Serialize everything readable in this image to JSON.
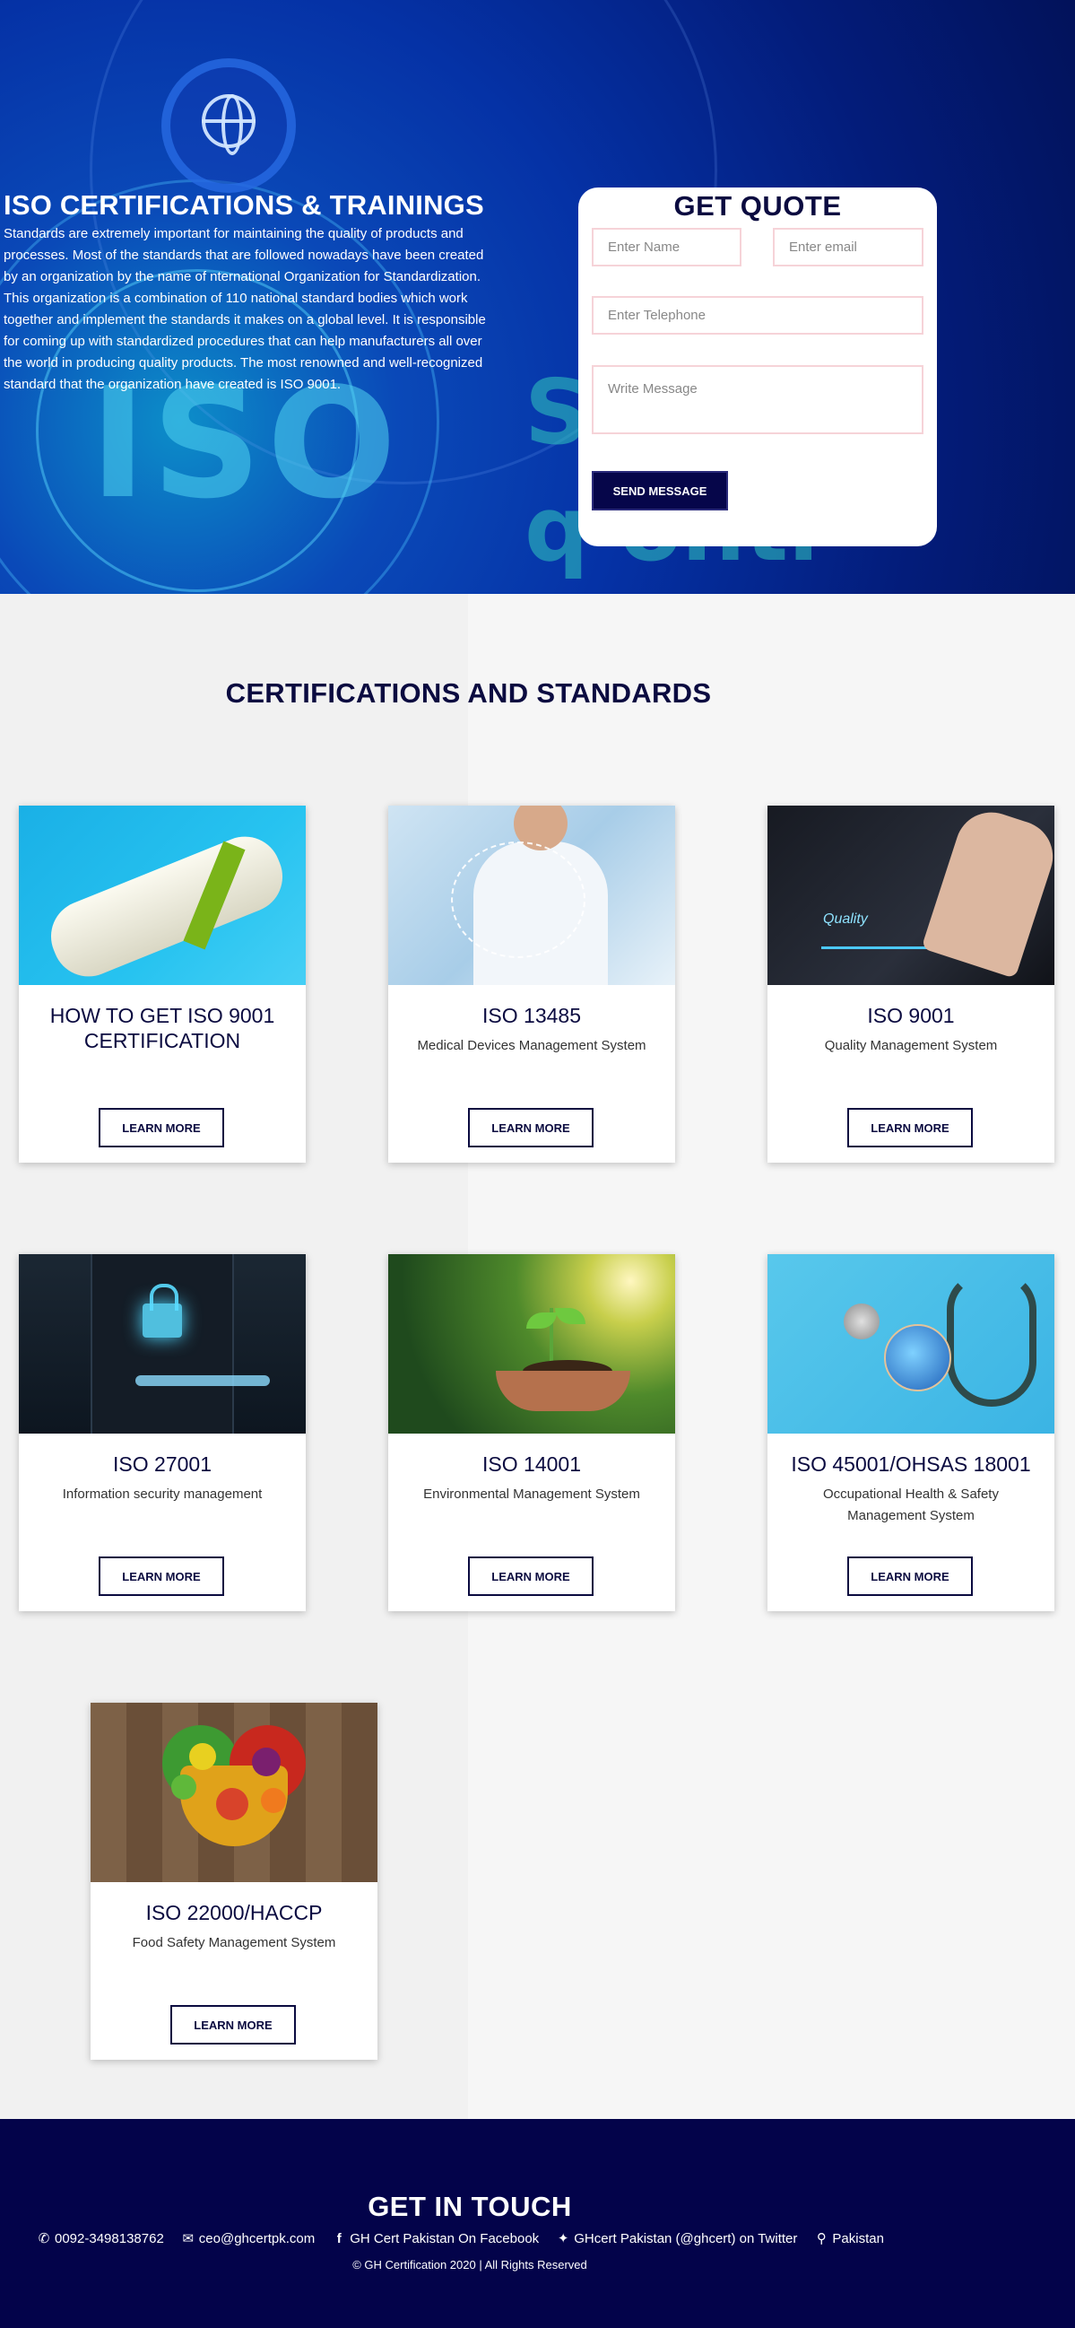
{
  "hero": {
    "title": "ISO CERTIFICATIONS & TRAININGS",
    "paragraph": "Standards are extremely important for maintaining the quality of products and processes. Most of the standards that are followed nowadays have been created by an organization by the name of nternational Organization for Standardization. This organization is a combination of 110 national standard bodies which work together and implement the standards it makes on a global level. It is responsible for coming up with standardized procedures that can help manufacturers all over the world in producing quality products. The most renowned and well-recognized standard that the organization have created is ISO 9001.",
    "background_big_text": "ISO",
    "background_side_text": [
      "S ds",
      "q  ontr"
    ]
  },
  "quote_form": {
    "title": "GET QUOTE",
    "name_placeholder": "Enter Name",
    "email_placeholder": "Enter email",
    "telephone_placeholder": "Enter Telephone",
    "message_placeholder": "Write Message",
    "send_label": "SEND MESSAGE"
  },
  "certifications": {
    "title": "CERTIFICATIONS AND STANDARDS",
    "button_label": "LEARN MORE",
    "cards": [
      {
        "title": "HOW TO GET ISO 9001 CERTIFICATION",
        "desc": "",
        "image": "diploma-scroll"
      },
      {
        "title": "ISO 13485",
        "desc": "Medical Devices Management System",
        "image": "doctor-medical"
      },
      {
        "title": "ISO 9001",
        "desc": "Quality Management System",
        "image": "quality-graph"
      },
      {
        "title": "ISO 27001",
        "desc": "Information security management",
        "image": "security-lock"
      },
      {
        "title": "ISO 14001",
        "desc": "Environmental Management System",
        "image": "plant-hands"
      },
      {
        "title": "ISO 45001/OHSAS 18001",
        "desc": "Occupational Health & Safety Management System",
        "image": "stethoscope-globe"
      },
      {
        "title": "ISO 22000/HACCP",
        "desc": "Food Safety Management System",
        "image": "fruit-heart"
      }
    ]
  },
  "footer": {
    "title": "GET IN TOUCH",
    "phone": "0092-3498138762",
    "email": "ceo@ghcertpk.com",
    "facebook": "GH Cert Pakistan On Facebook",
    "twitter": "GHcert Pakistan (@ghcert) on Twitter",
    "location": "Pakistan",
    "copyright": "© GH Certification 2020 | All Rights Reserved"
  },
  "colors": {
    "navy": "#0b0b40",
    "footer_bg": "#03034a",
    "hero_blue": "#0532a6",
    "field_border": "#f6d3d8"
  }
}
